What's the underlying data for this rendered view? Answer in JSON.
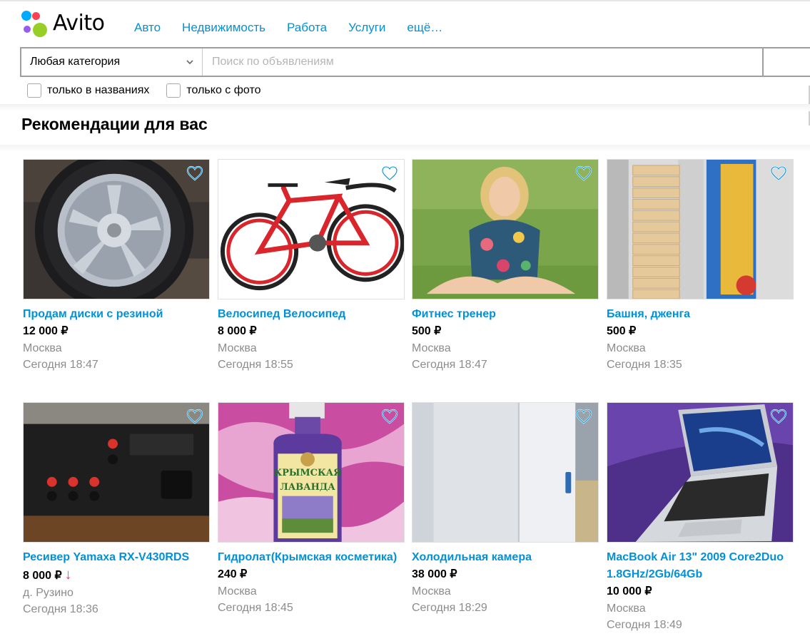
{
  "header": {
    "logo_text": "Avito",
    "nav": [
      "Авто",
      "Недвижимость",
      "Работа",
      "Услуги",
      "ещё…"
    ]
  },
  "search": {
    "category_value": "Любая категория",
    "placeholder": "Поиск по объявлениям",
    "only_titles_label": "только в названиях",
    "only_photo_label": "только с фото"
  },
  "section": {
    "title": "Рекомендации для вас"
  },
  "colors": {
    "link": "#0091d9",
    "price_drop": "#f5414f",
    "muted": "#8c8c8c"
  },
  "cards": [
    {
      "title": "Продам диски с резиной",
      "price": "12 000 ₽",
      "location": "Москва",
      "time": "Сегодня 18:47",
      "image": "car-wheel-photo"
    },
    {
      "title": "Велосипед Велосипед",
      "price": "8 000 ₽",
      "location": "Москва",
      "time": "Сегодня 18:55",
      "image": "red-bicycle-photo"
    },
    {
      "title": "Фитнес тренер",
      "price": "500 ₽",
      "location": "Москва",
      "time": "Сегодня 18:47",
      "image": "woman-on-grass-photo"
    },
    {
      "title": "Башня, дженга",
      "price": "500 ₽",
      "location": "Москва",
      "time": "Сегодня 18:35",
      "image": "jenga-tower-photo"
    },
    {
      "title": "Ресивер Yamaxa RX-V430RDS",
      "price": "8 000 ₽",
      "price_drop_icon": "↓",
      "location": "д. Рузино",
      "time": "Сегодня 18:36",
      "image": "receiver-back-panel-photo"
    },
    {
      "title": "Гидролат(Крымская косметика)",
      "price": "240 ₽",
      "location": "Москва",
      "time": "Сегодня 18:45",
      "image": "lavender-bottle-photo",
      "image_text": [
        "КРЫМСКАЯ",
        "ЛАВАНДА"
      ]
    },
    {
      "title": "Холодильная камера",
      "price": "38 000 ₽",
      "location": "Москва",
      "time": "Сегодня 18:29",
      "image": "cold-room-photo"
    },
    {
      "title": "MacBook Air 13\" 2009 Core2Duo 1.8GHz/2Gb/64Gb",
      "price": "10 000 ₽",
      "location": "Москва",
      "time": "Сегодня 18:49",
      "image": "macbook-photo"
    }
  ]
}
